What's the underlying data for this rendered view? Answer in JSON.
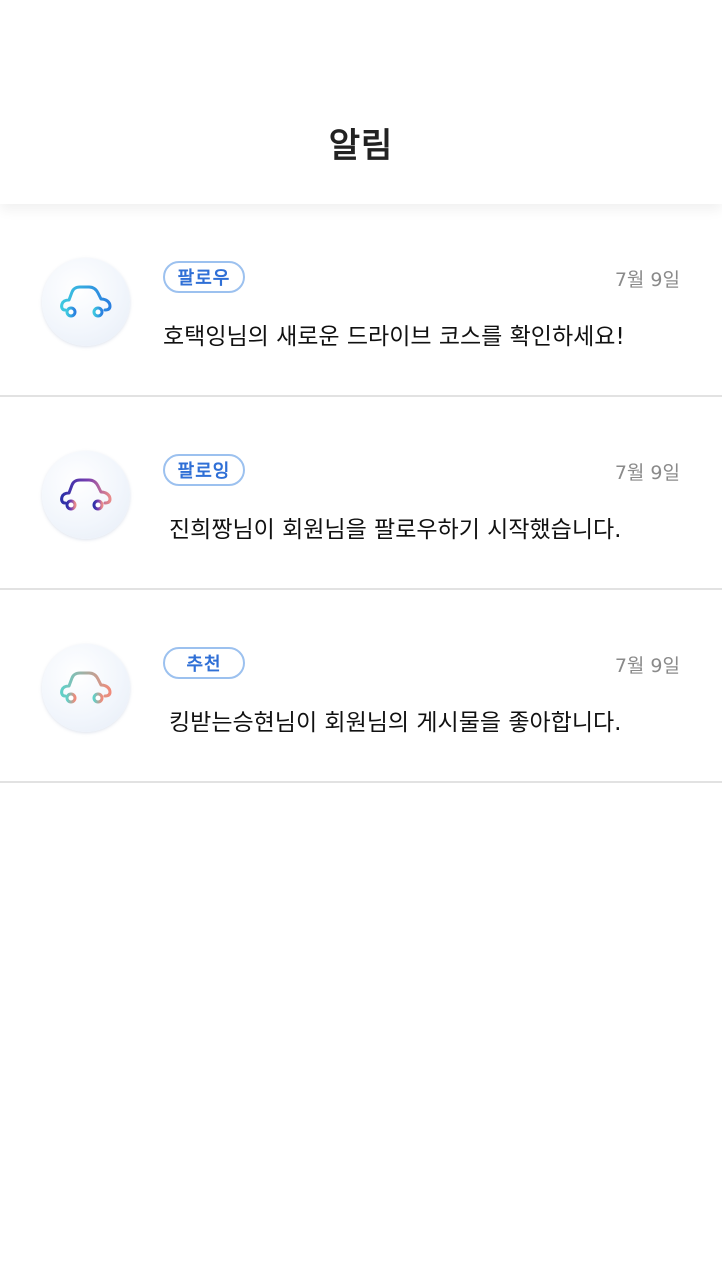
{
  "header": {
    "title": "알림"
  },
  "notifications": [
    {
      "badge": "팔로우",
      "date": "7월 9일",
      "message": "호택잉님의 새로운 드라이브 코스를 확인하세요!",
      "icon": "car-icon",
      "colors": [
        "#3ec8e0",
        "#2a7fe0"
      ]
    },
    {
      "badge": "팔로잉",
      "date": "7월 9일",
      "message": "진희짱님이 회원님을 팔로우하기 시작했습니다.",
      "icon": "car-icon",
      "colors": [
        "#2b2fa8",
        "#e88a8a"
      ]
    },
    {
      "badge": "추천",
      "date": "7월 9일",
      "message": "킹받는승현님이 회원님의 게시물을 좋아합니다.",
      "icon": "car-icon",
      "colors": [
        "#5fd0c8",
        "#f08a7a"
      ]
    }
  ]
}
